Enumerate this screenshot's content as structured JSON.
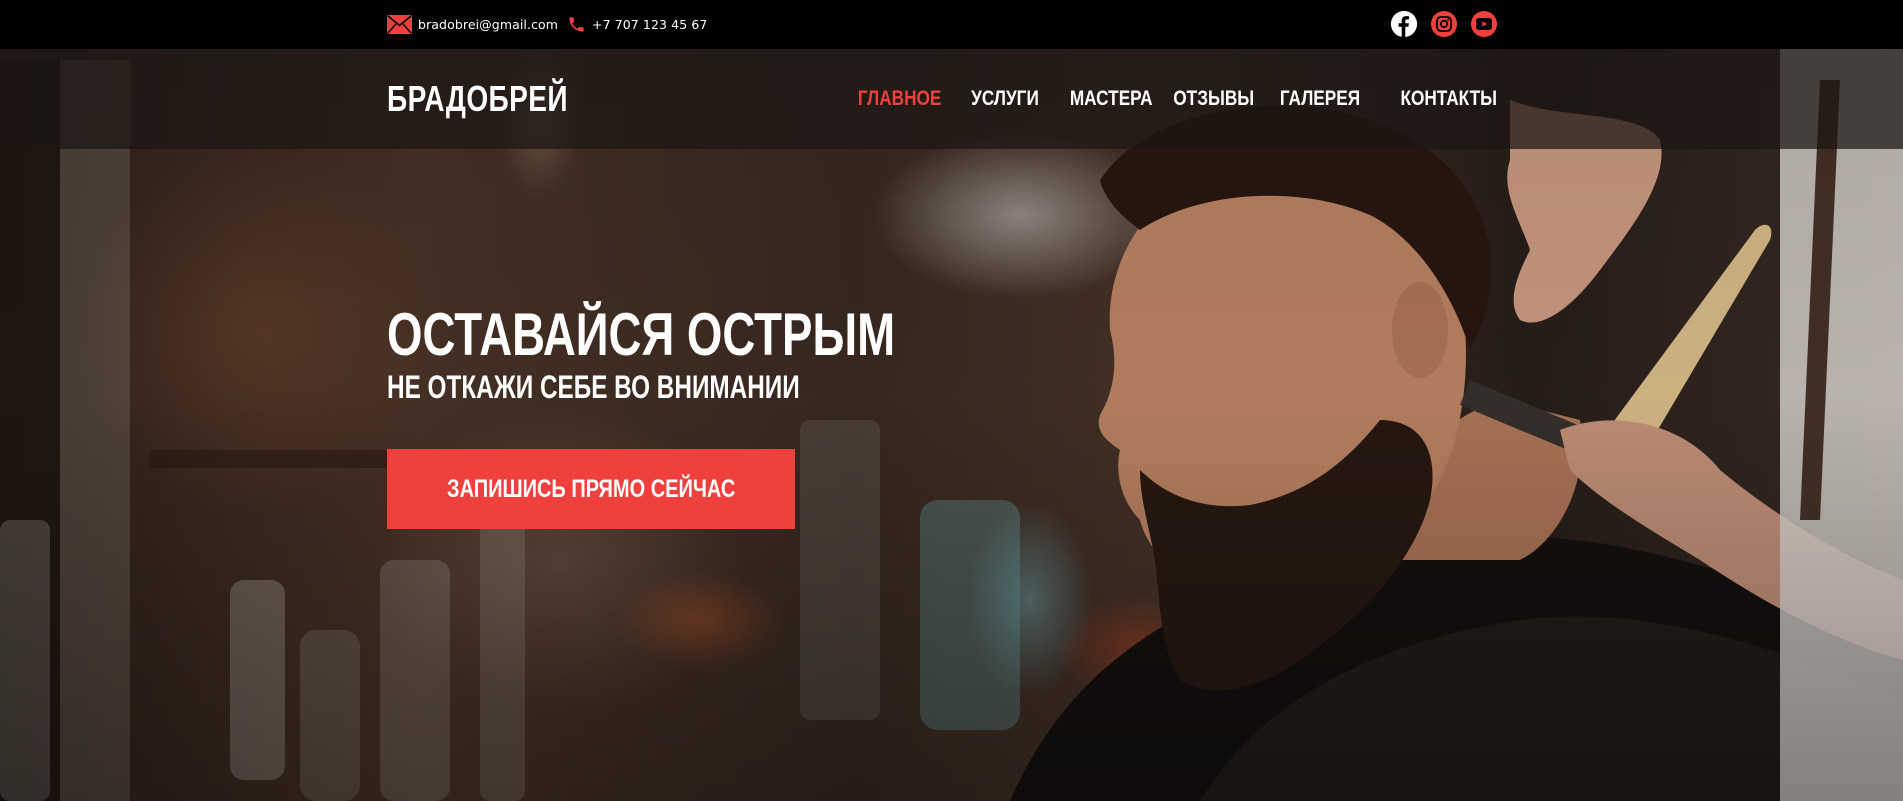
{
  "contacts": {
    "email": {
      "icon": "envelope-icon",
      "text": "bradobrei@gmail.com"
    },
    "phone": {
      "icon": "phone-icon",
      "text": "+7 707 123 45 67"
    }
  },
  "socials": [
    {
      "name": "facebook",
      "icon": "facebook-icon",
      "bg": "#ffffff"
    },
    {
      "name": "instagram",
      "icon": "instagram-icon",
      "bg": "#f0403d"
    },
    {
      "name": "youtube",
      "icon": "youtube-icon",
      "bg": "#f0403d"
    }
  ],
  "header": {
    "logo": "БРАДОБРЕЙ",
    "nav": [
      {
        "label": "ГЛАВНОЕ",
        "active": true
      },
      {
        "label": "УСЛУГИ",
        "active": false
      },
      {
        "label": "МАСТЕРА",
        "active": false
      },
      {
        "label": "ОТЗЫВЫ",
        "active": false
      },
      {
        "label": "ГАЛЕРЕЯ",
        "active": false
      },
      {
        "label": "КОНТАКТЫ",
        "active": false
      }
    ]
  },
  "hero": {
    "title": "ОСТАВАЙСЯ ОСТРЫМ",
    "subtitle": "НЕ ОТКАЖИ СЕБЕ ВО ВНИМАНИИ",
    "cta_label": "ЗАПИШИСЬ ПРЯМО СЕЙЧАС"
  },
  "colors": {
    "accent": "#f0403d",
    "topbar": "#000000",
    "text": "#ffffff"
  }
}
